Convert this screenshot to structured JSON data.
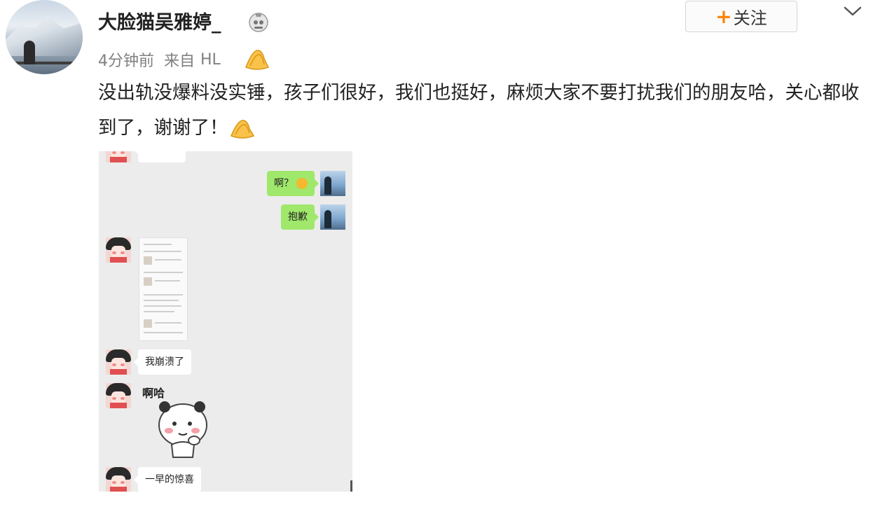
{
  "post": {
    "author": "大脸猫吴雅婷_",
    "time": "4分钟前",
    "source_prefix": "来自",
    "source": "HL",
    "follow_label": "关注",
    "follow_plus": "+",
    "text": "没出轨没爆料没实锤，孩子们很好，我们也挺好，麻烦大家不要打扰我们的朋友哈，关心都收到了，谢谢了！"
  },
  "chat": {
    "messages": [
      {
        "side": "right",
        "text": "啊？"
      },
      {
        "side": "right",
        "text": "抱歉"
      },
      {
        "side": "left",
        "type": "image"
      },
      {
        "side": "left",
        "text": "我崩溃了"
      },
      {
        "side": "left",
        "type": "sticker",
        "text": "啊哈"
      },
      {
        "side": "left",
        "text": "一早的惊喜"
      }
    ]
  },
  "colors": {
    "follow_plus": "#ff8200",
    "green_bubble": "#9fe86b",
    "chat_bg": "#ececec"
  },
  "icons": [
    "avatar",
    "vip-badge-icon",
    "clap-emoji-icon",
    "chevron-down-icon",
    "smiley-icon"
  ]
}
